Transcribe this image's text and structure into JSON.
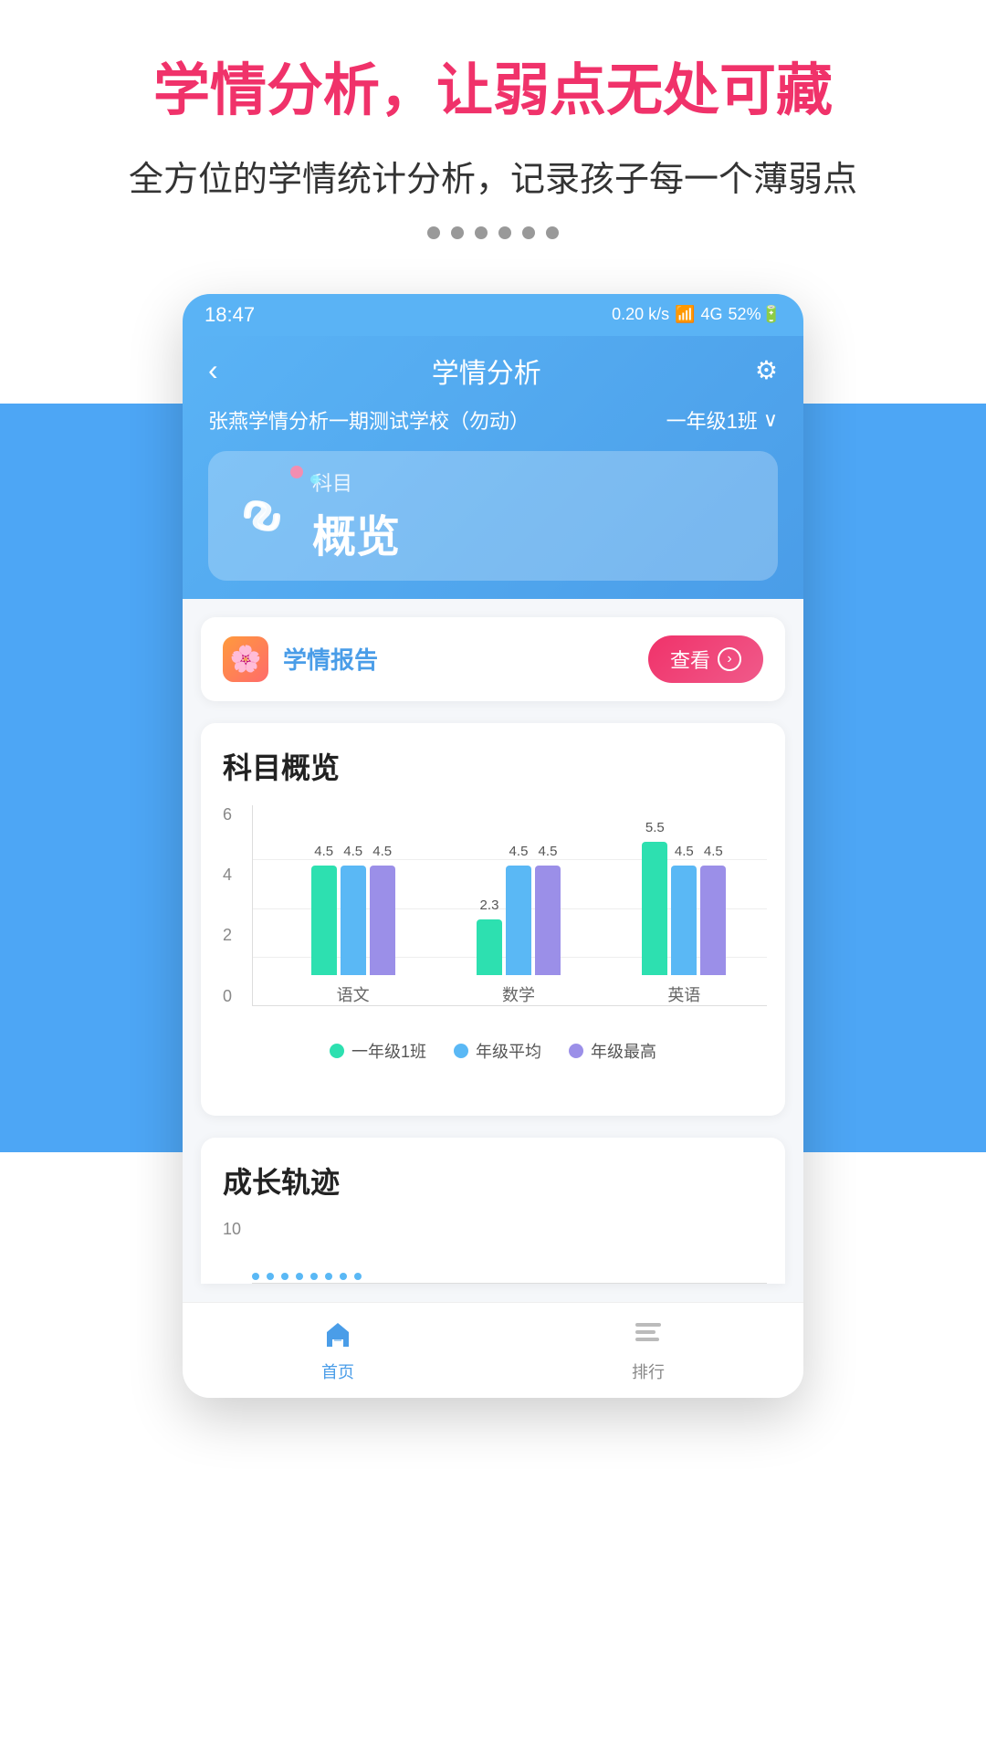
{
  "marketing": {
    "title": "学情分析，让弱点无处可藏",
    "subtitle": "全方位的学情统计分析，记录孩子每一个薄弱点",
    "dots_count": 6
  },
  "status_bar": {
    "time": "18:47",
    "icons": "0.20 k/s ⏰ WiFi HD 4G HD 4G 52%"
  },
  "header": {
    "back_label": "‹",
    "title": "学情分析",
    "settings_icon": "⚙",
    "school_name": "张燕学情分析一期测试学校（勿动）",
    "class_name": "一年级1班",
    "chevron": "∨"
  },
  "subject_card": {
    "subject_label": "科目",
    "subject_value": "概览"
  },
  "report_card": {
    "icon": "🌸",
    "title": "学情报告",
    "view_label": "查看",
    "arrow": "›"
  },
  "chart_section": {
    "title": "科目概览",
    "y_axis": [
      "0",
      "2",
      "4",
      "6"
    ],
    "groups": [
      {
        "label": "语文",
        "bars": [
          {
            "value": 4.5,
            "label": "4.5",
            "color": "green"
          },
          {
            "value": 4.5,
            "label": "4.5",
            "color": "blue"
          },
          {
            "value": 4.5,
            "label": "4.5",
            "color": "purple"
          }
        ]
      },
      {
        "label": "数学",
        "bars": [
          {
            "value": 2.3,
            "label": "2.3",
            "color": "green"
          },
          {
            "value": 4.5,
            "label": "4.5",
            "color": "blue"
          },
          {
            "value": 4.5,
            "label": "4.5",
            "color": "purple"
          }
        ]
      },
      {
        "label": "英语",
        "bars": [
          {
            "value": 5.5,
            "label": "5.5",
            "color": "green"
          },
          {
            "value": 4.5,
            "label": "4.5",
            "color": "blue"
          },
          {
            "value": 4.5,
            "label": "4.5",
            "color": "purple"
          }
        ]
      }
    ],
    "legend": [
      {
        "label": "一年级1班",
        "color": "#2de0b0"
      },
      {
        "label": "年级平均",
        "color": "#5ab8f5"
      },
      {
        "label": "年级最高",
        "color": "#9b8fe8"
      }
    ]
  },
  "growth_section": {
    "title": "成长轨迹",
    "y_max": "10"
  },
  "bottom_nav": {
    "items": [
      {
        "label": "首页",
        "active": true,
        "icon": "home"
      },
      {
        "label": "排行",
        "active": false,
        "icon": "ranking"
      }
    ]
  }
}
